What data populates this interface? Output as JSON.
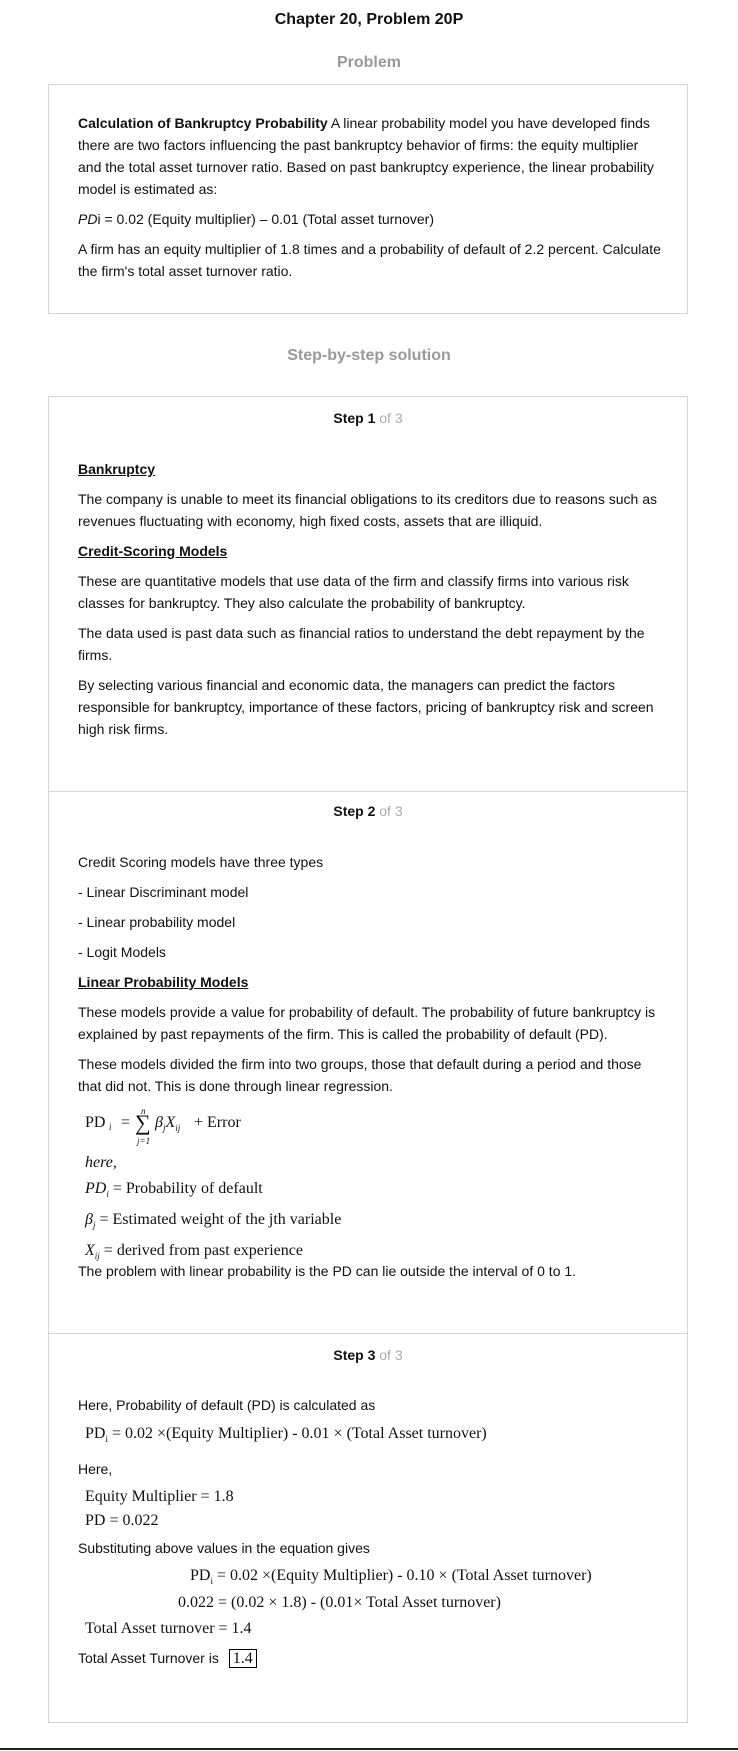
{
  "header": {
    "title": "Chapter 20, Problem 20P",
    "problem_label": "Problem",
    "solution_label": "Step-by-step solution"
  },
  "problem": {
    "lead": "Calculation of Bankruptcy Probability",
    "p1": "A linear probability model you have developed finds there are two factors influencing the past bankruptcy behavior of firms: the equity multiplier and the total asset turnover ratio. Based on past bankruptcy experience, the linear probability model is estimated as:",
    "eq_pd": "PD",
    "eq_rest": "i = 0.02 (Equity multiplier) – 0.01 (Total asset turnover)",
    "p2": "A firm has an equity multiplier of 1.8 times and a probability of default of 2.2 percent. Calculate the firm's total asset turnover ratio."
  },
  "step1": {
    "label": "Step 1",
    "of": "of 3",
    "h1": "Bankruptcy",
    "t1": "The company is unable to meet its financial obligations to its creditors due to reasons such as revenues fluctuating with economy, high fixed costs, assets that are illiquid.",
    "h2": "Credit-Scoring Models",
    "t2": "These are quantitative models that use data of the firm and classify firms into various risk classes for bankruptcy. They also calculate the probability of bankruptcy.",
    "t3": "The data used is past data such as financial ratios to understand the debt repayment by the firms.",
    "t4": "By selecting various financial and economic data, the managers can predict the factors responsible for bankruptcy, importance of these factors, pricing of bankruptcy risk and screen high risk firms."
  },
  "step2": {
    "label": "Step 2",
    "of": "of 3",
    "intro": "Credit Scoring models have three types",
    "types": [
      "- Linear Discriminant model",
      "- Linear probability model",
      "- Logit Models"
    ],
    "h1": "Linear Probability Models",
    "t1": "These models provide a value for probability of default. The probability of future bankruptcy is explained by past repayments of the firm. This is called the probability of default (PD).",
    "t2": "These models divided the firm into two groups, those that default during a period and those that did not. This is done through linear regression.",
    "eq_lhs": "PD",
    "eq_sum_top": "n",
    "eq_sum_bot": "j=1",
    "eq_error": "+  Error",
    "here": "here,",
    "def1_sym": "PD",
    "def1": "=  Probability of default",
    "def2_sym": "β",
    "def2": "= Estimated weight of the jth variable",
    "def3_sym": "X",
    "def3": "=  derived from past experience",
    "t3": "The problem with linear probability is the PD can lie outside the interval of 0 to 1."
  },
  "step3": {
    "label": "Step 3",
    "of": "of 3",
    "intro": "Here, Probability of default (PD) is calculated as",
    "eq1": "= 0.02 ×(Equity Multiplier) - 0.01 ×  (Total Asset turnover)",
    "here": "Here,",
    "given1": "Equity Multiplier = 1.8",
    "given2": "PD  = 0.022",
    "subst": "Substituting above values in the equation gives",
    "eq2": "= 0.02 ×(Equity Multiplier) - 0.10 ×  (Total Asset turnover)",
    "eq3": "0.022 = (0.02 ×  1.8) - (0.01×  Total Asset turnover)",
    "eq4": "Total Asset turnover =  1.4",
    "answer_label": "Total Asset Turnover is",
    "answer": "1.4"
  }
}
